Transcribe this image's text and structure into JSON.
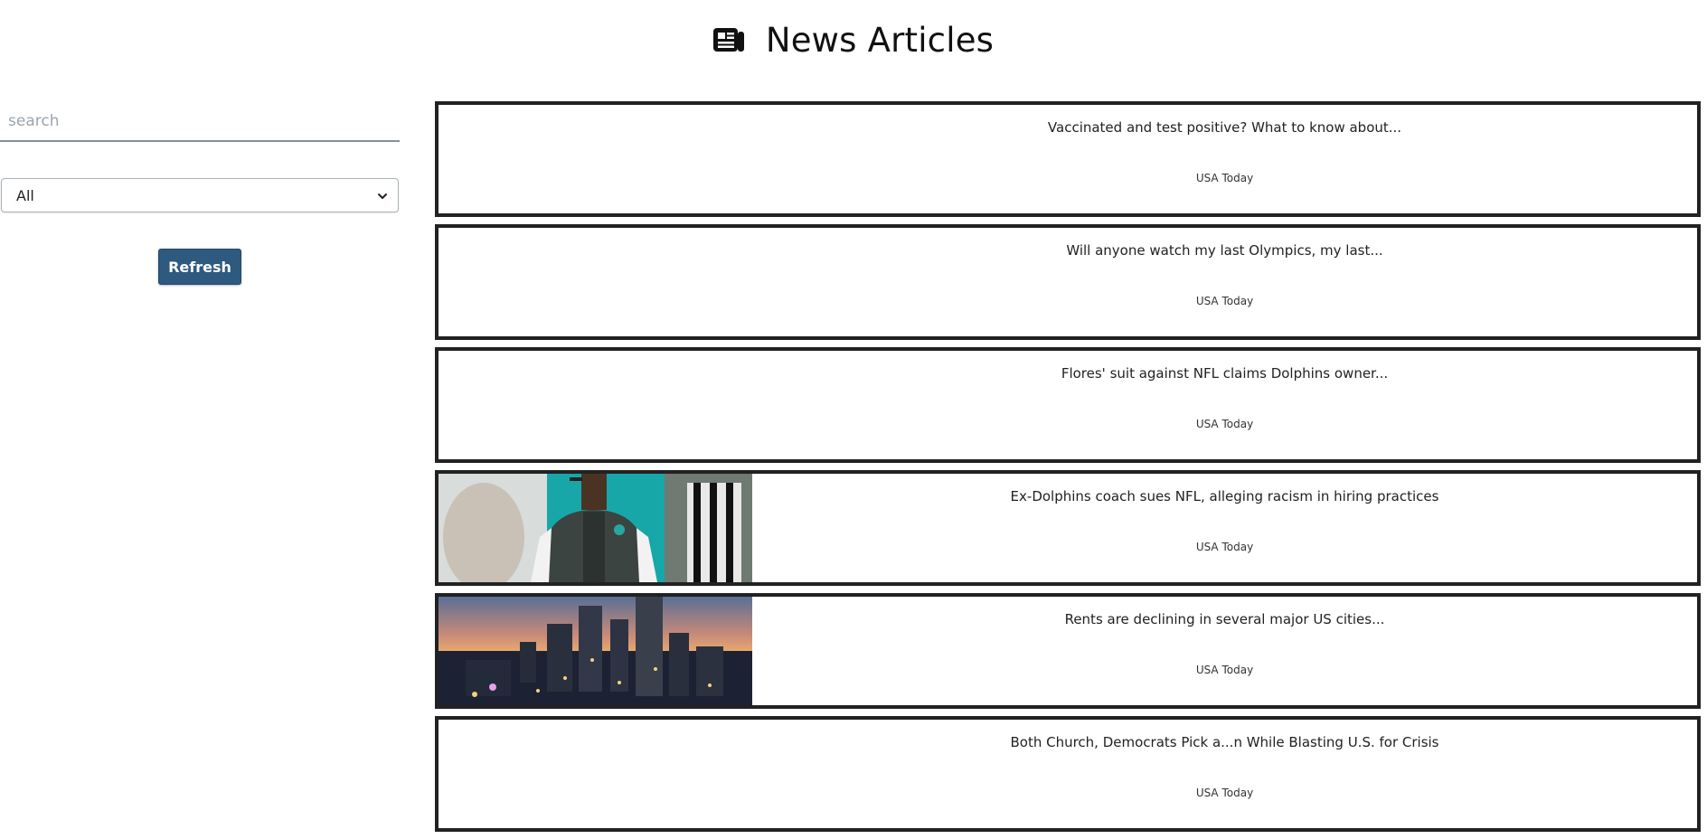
{
  "header": {
    "title": "News Articles",
    "icon": "newspaper-icon"
  },
  "sidebar": {
    "search_placeholder": "search",
    "search_value": "",
    "category_selected": "All",
    "refresh_label": "Refresh"
  },
  "articles": [
    {
      "title": "Vaccinated and test positive? What to know about...",
      "source": "USA Today",
      "thumbnail": "none"
    },
    {
      "title": "Will anyone watch my last Olympics, my last...",
      "source": "USA Today",
      "thumbnail": "none"
    },
    {
      "title": "Flores' suit against NFL claims Dolphins owner...",
      "source": "USA Today",
      "thumbnail": "none"
    },
    {
      "title": "Ex-Dolphins coach sues NFL, alleging racism in hiring practices",
      "source": "USA Today",
      "thumbnail": "coach-photo"
    },
    {
      "title": "Rents are declining in several major US cities...",
      "source": "USA Today",
      "thumbnail": "city-skyline-photo"
    },
    {
      "title": "Both Church, Democrats Pick a...n While Blasting U.S. for Crisis",
      "source": "USA Today",
      "thumbnail": "none"
    }
  ],
  "colors": {
    "accent": "#2e5a80",
    "card_border": "#222222"
  }
}
